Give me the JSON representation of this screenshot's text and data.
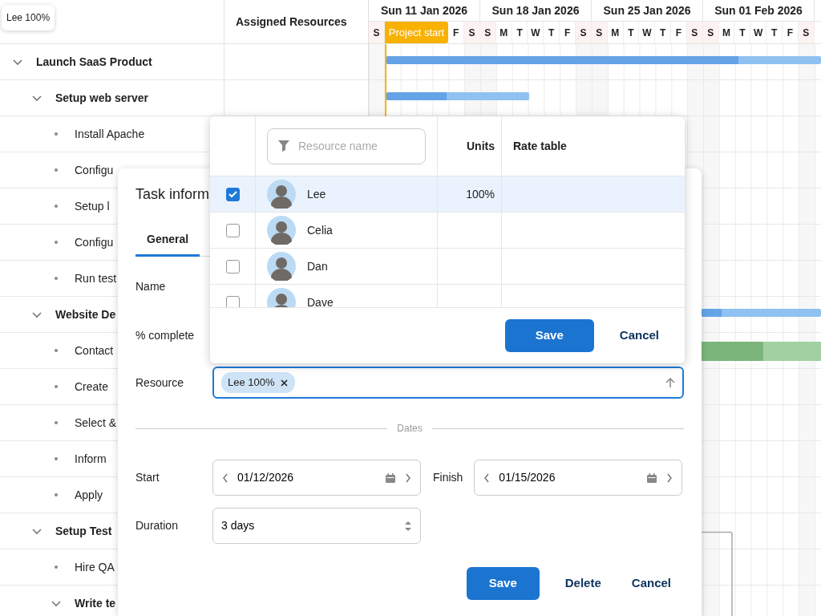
{
  "tooltip": {
    "text": "Lee 100%"
  },
  "grid": {
    "resources_header": "Assigned Resources"
  },
  "tasks": [
    {
      "name": "Launch SaaS Product",
      "kind": "parent",
      "expanded": true,
      "bar": {
        "level": 0.81
      },
      "children": [
        {
          "name": "Setup web server",
          "kind": "parent",
          "expanded": true,
          "bar": {
            "level": 0.42
          },
          "children": [
            {
              "name": "Install Apache",
              "kind": "leaf"
            },
            {
              "name": "Configu",
              "kind": "leaf"
            },
            {
              "name": "Setup l",
              "kind": "leaf"
            },
            {
              "name": "Configu",
              "kind": "leaf"
            },
            {
              "name": "Run test",
              "kind": "leaf"
            }
          ]
        },
        {
          "name": "Website De",
          "kind": "parent",
          "expanded": true,
          "bar": {
            "level": 0.17
          },
          "children": [
            {
              "name": "Contact",
              "kind": "leaf",
              "bar": {
                "level": 0.52
              }
            },
            {
              "name": "Create",
              "kind": "leaf"
            },
            {
              "name": "Select &",
              "kind": "leaf"
            },
            {
              "name": "Inform",
              "kind": "leaf"
            },
            {
              "name": "Apply",
              "kind": "leaf"
            }
          ]
        },
        {
          "name": "Setup Test",
          "kind": "parent",
          "expanded": true,
          "children": [
            {
              "name": "Hire QA",
              "kind": "leaf"
            },
            {
              "name": "Write te",
              "kind": "parent",
              "expanded": true
            }
          ]
        }
      ]
    }
  ],
  "timeline": {
    "weeks": [
      "Sun 11 Jan 2026",
      "Sun 18 Jan 2026",
      "Sun 25 Jan 2026",
      "Sun 01 Feb 2026"
    ],
    "days": [
      {
        "label": "S",
        "weekend": true
      },
      {
        "label": "F",
        "weekend": false
      },
      {
        "label": "S",
        "weekend": true
      },
      {
        "label": "S",
        "weekend": true
      },
      {
        "label": "M",
        "weekend": false
      },
      {
        "label": "T",
        "weekend": false
      },
      {
        "label": "W",
        "weekend": false
      },
      {
        "label": "T",
        "weekend": false
      },
      {
        "label": "F",
        "weekend": false
      },
      {
        "label": "S",
        "weekend": true
      },
      {
        "label": "S",
        "weekend": true
      },
      {
        "label": "M",
        "weekend": false
      },
      {
        "label": "T",
        "weekend": false
      },
      {
        "label": "W",
        "weekend": false
      },
      {
        "label": "T",
        "weekend": false
      },
      {
        "label": "F",
        "weekend": false
      },
      {
        "label": "S",
        "weekend": true
      },
      {
        "label": "S",
        "weekend": true
      },
      {
        "label": "M",
        "weekend": false
      },
      {
        "label": "T",
        "weekend": false
      },
      {
        "label": "W",
        "weekend": false
      },
      {
        "label": "T",
        "weekend": false
      },
      {
        "label": "F",
        "weekend": false
      },
      {
        "label": "S",
        "weekend": true
      }
    ],
    "project_line": {
      "label": "Project start"
    }
  },
  "task_dialog": {
    "title": "Task inform",
    "tabs": [
      {
        "label": "General",
        "selected": true
      }
    ],
    "name_label": "Name",
    "percent_label": "% complete",
    "resource": {
      "label": "Resource",
      "focused": true,
      "chips": [
        "Lee 100%"
      ]
    },
    "dates_divider": "Dates",
    "start": {
      "label": "Start",
      "value": "01/12/2026"
    },
    "finish": {
      "label": "Finish",
      "value": "01/15/2026"
    },
    "duration": {
      "label": "Duration",
      "value": "3 days"
    },
    "buttons": [
      {
        "label": "Save",
        "kind": "primary"
      },
      {
        "label": "Delete",
        "kind": "flat"
      },
      {
        "label": "Cancel",
        "kind": "flat"
      }
    ]
  },
  "resource_picker": {
    "filter": {
      "placeholder": "Resource name"
    },
    "columns": [
      "Units",
      "Rate table"
    ],
    "rows": [
      {
        "name": "Lee",
        "checked": true,
        "selected": true,
        "units": "100%"
      },
      {
        "name": "Celia",
        "checked": false,
        "selected": false
      },
      {
        "name": "Dan",
        "checked": false,
        "selected": false
      },
      {
        "name": "Dave",
        "checked": false,
        "selected": false
      }
    ],
    "buttons": [
      {
        "label": "Save",
        "kind": "primary"
      },
      {
        "label": "Cancel",
        "kind": "flat"
      }
    ]
  }
}
